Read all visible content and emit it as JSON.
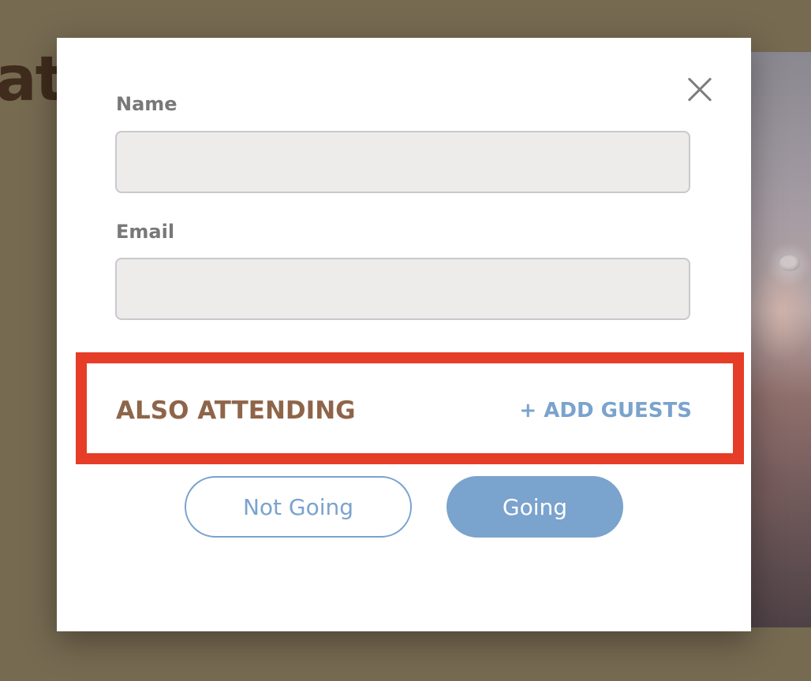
{
  "background": {
    "heading_fragment": "at"
  },
  "form": {
    "name_label": "Name",
    "name_value": "",
    "email_label": "Email",
    "email_value": ""
  },
  "attending": {
    "title": "ALSO ATTENDING",
    "add_guests_label": "+ ADD GUESTS"
  },
  "actions": {
    "not_going_label": "Not Going",
    "going_label": "Going"
  },
  "colors": {
    "accent_blue": "#7aa3cd",
    "title_brown": "#8e6549",
    "highlight_red": "#e53d27",
    "backdrop": "#766a51"
  }
}
